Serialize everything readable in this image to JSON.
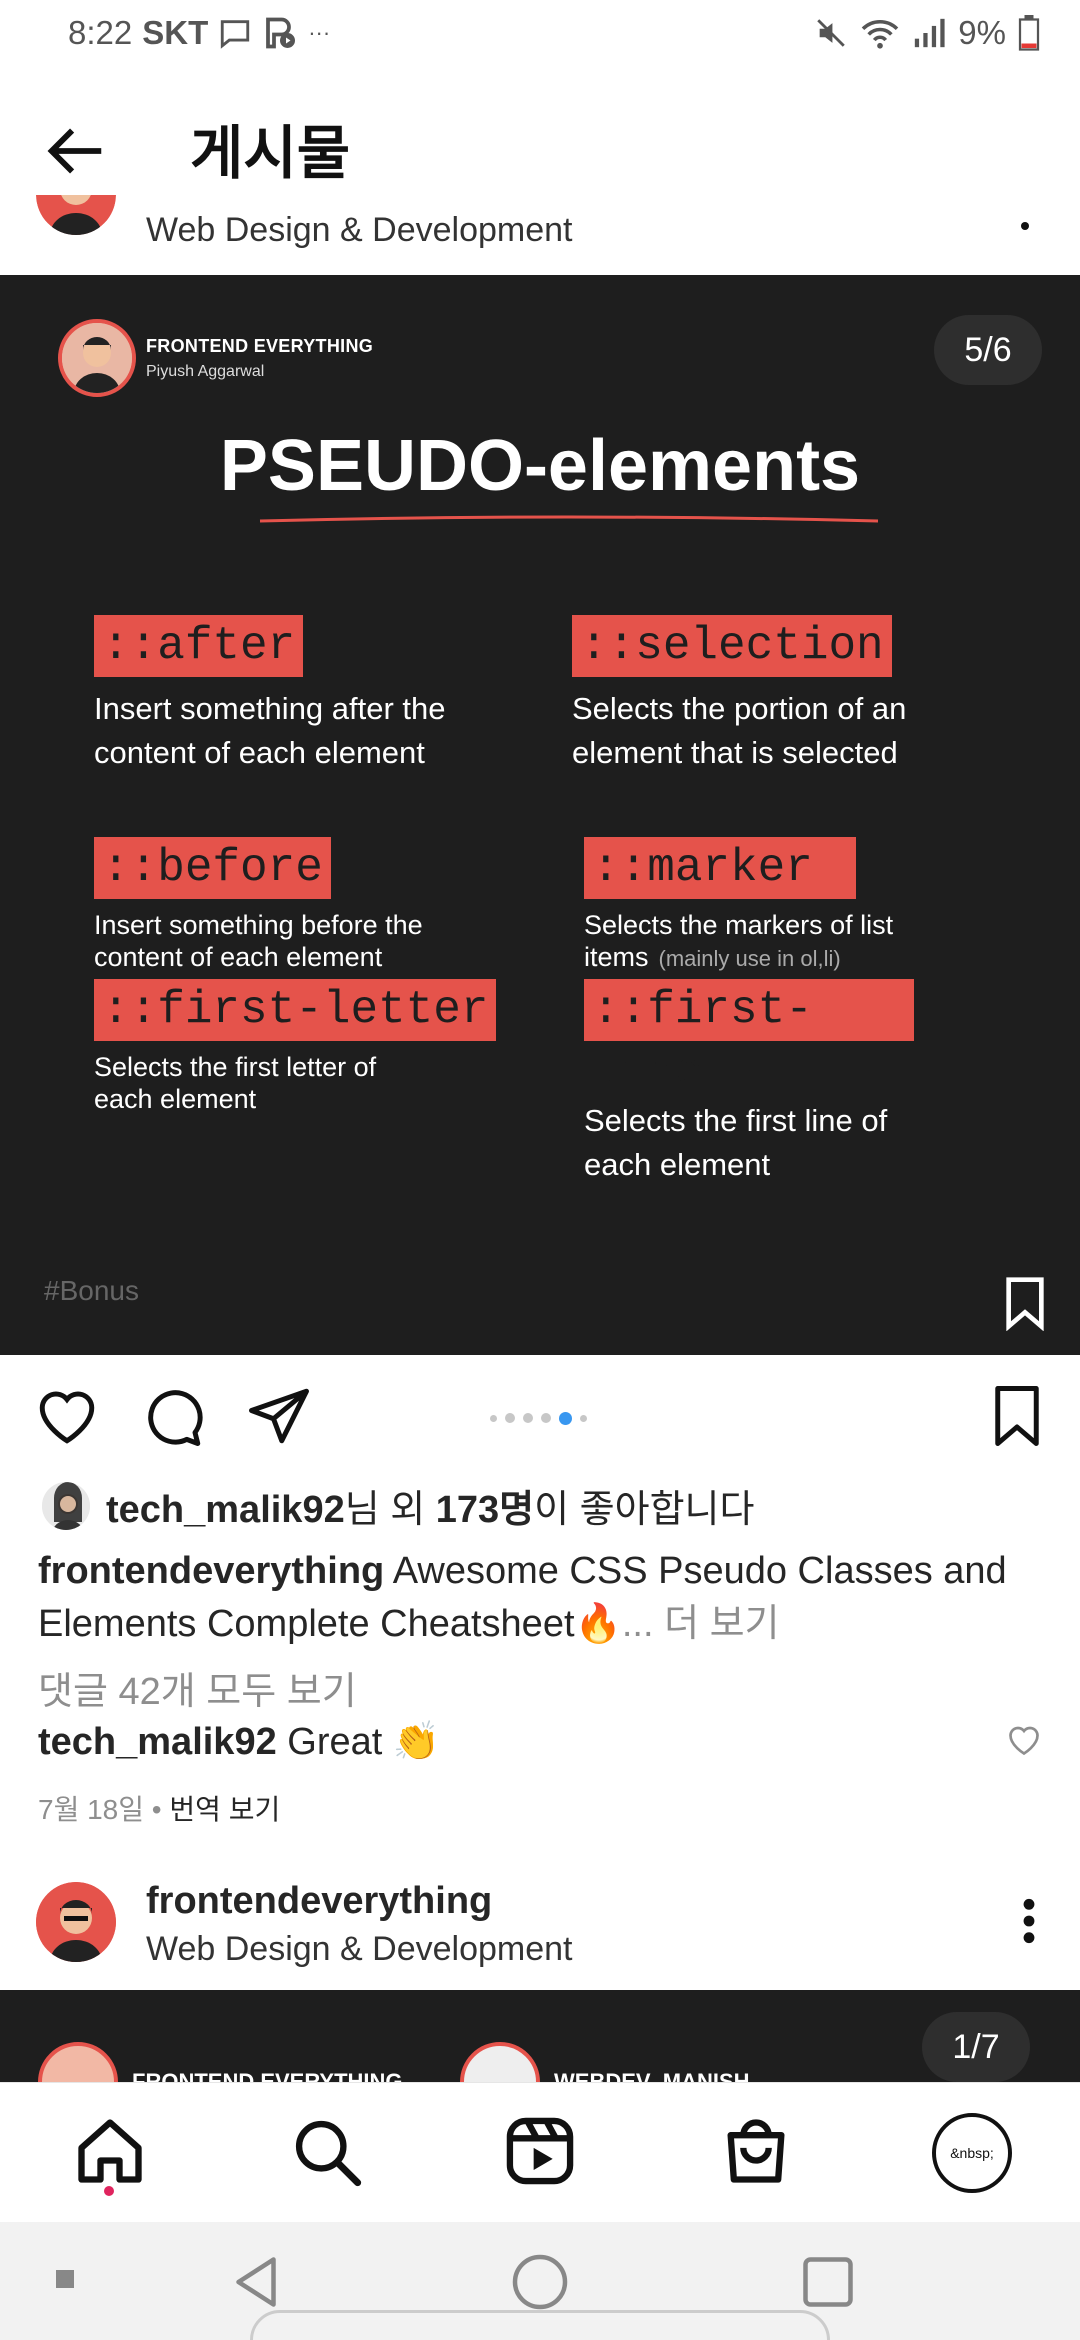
{
  "status_bar": {
    "time": "8:22",
    "carrier": "SKT",
    "battery": "9%",
    "more": "···"
  },
  "header": {
    "title": "게시물"
  },
  "top_post": {
    "subtitle": "Web Design & Development"
  },
  "slide": {
    "brand_name": "FRONTEND EVERYTHING",
    "author": "Piyush Aggarwal",
    "counter": "5/6",
    "title": "PSEUDO-elements",
    "items": [
      {
        "tag": "::after",
        "desc": " Insert something after the content of each element"
      },
      {
        "tag": "::selection",
        "desc": "Selects the portion of an element that is selected"
      },
      {
        "tag": "::before",
        "desc": "Insert something before the content of each element"
      },
      {
        "tag": "::marker ",
        "desc": "Selects the markers of list items",
        "note": "(mainly use in ol,li)"
      },
      {
        "tag": "::first-letter",
        "desc": "Selects the first letter of each element"
      },
      {
        "tag": "::first-line",
        "desc": "Selects the first line of each element"
      }
    ],
    "hashtag": "#Bonus"
  },
  "carousel_dots": {
    "count": 6,
    "active_index": 4
  },
  "likes": {
    "user": "tech_malik92",
    "mid": "님 외 ",
    "count": "173명",
    "suffix": "이 좋아합니다"
  },
  "caption": {
    "user": "frontendeverything",
    "text": " Awesome CSS Pseudo Classes and Elements Complete Cheatsheet",
    "emoji": "🔥",
    "more": "... 더 보기"
  },
  "comments": {
    "all_label": "댓글 42개 모두 보기",
    "top_user": "tech_malik92",
    "top_text": " Great 👏"
  },
  "meta": {
    "date": "7월 18일",
    "separator": " • ",
    "translate": "번역 보기"
  },
  "next_post": {
    "username": "frontendeverything",
    "subtitle": "Web Design & Development",
    "brand1": "FRONTEND EVERYTHING",
    "brand2": "WEBDEV_MANISH",
    "counter": "1/7"
  },
  "profile": {
    "label": "&nbsp;"
  },
  "colors": {
    "accent_red": "#e5534b",
    "slide_bg": "#1e1e1e",
    "active_dot": "#3897f0"
  }
}
